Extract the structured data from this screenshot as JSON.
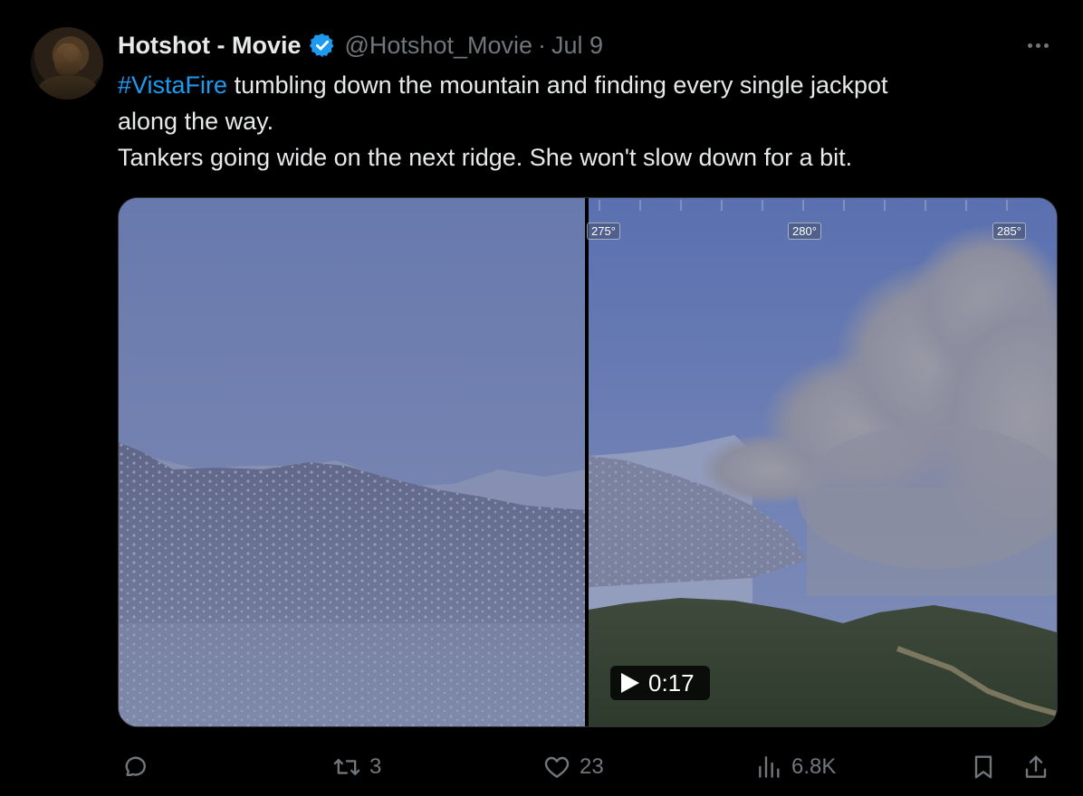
{
  "tweet": {
    "display_name": "Hotshot - Movie",
    "handle": "@Hotshot_Movie",
    "separator": "·",
    "date": "Jul 9",
    "hashtag": "#VistaFire",
    "text_line1_rest": " tumbling down the mountain and finding every single jackpot",
    "text_line2": "along the way.",
    "text_line3": "Tankers going wide on the next ridge. She won't slow down for a bit."
  },
  "media": {
    "degree_labels": [
      "275°",
      "280°",
      "285°"
    ],
    "duration": "0:17"
  },
  "actions": {
    "reply_count": "",
    "retweet_count": "3",
    "like_count": "23",
    "views_count": "6.8K"
  },
  "icons": {
    "verified": "verified-badge-icon",
    "more": "more-options-icon",
    "reply": "reply-icon",
    "retweet": "retweet-icon",
    "like": "heart-icon",
    "views": "views-chart-icon",
    "bookmark": "bookmark-icon",
    "share": "share-icon",
    "play": "play-icon"
  },
  "colors": {
    "background": "#000000",
    "text": "#e7e9ea",
    "muted": "#71767b",
    "link": "#1d9bf0",
    "verified": "#1d9bf0"
  }
}
